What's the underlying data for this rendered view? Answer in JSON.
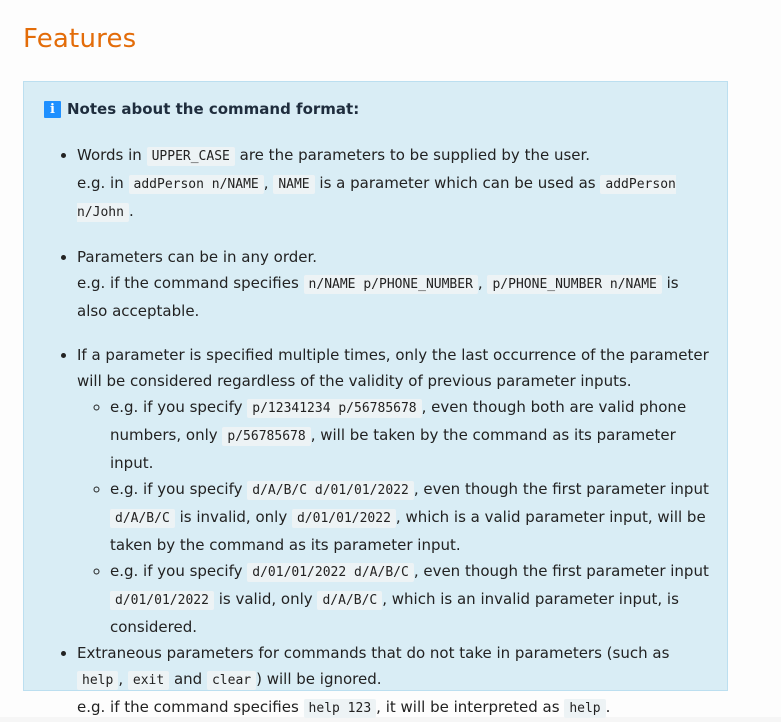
{
  "page": {
    "title": "Features"
  },
  "notes": {
    "heading": "Notes about the command format:",
    "icon": "info-icon",
    "items": [
      {
        "p1_a": "Words in",
        "p1_code1": "UPPER_CASE",
        "p1_b": "are the parameters to be supplied by the user.",
        "p2_a": "e.g. in",
        "p2_code1": "addPerson n/NAME",
        "p2_b": ",",
        "p2_code2": "NAME",
        "p2_c": "is a parameter which can be used as",
        "p2_code3": "addPerson n/John",
        "p2_d": "."
      },
      {
        "p1": "Parameters can be in any order.",
        "p2_a": "e.g. if the command specifies",
        "p2_code1": "n/NAME p/PHONE_NUMBER",
        "p2_b": ",",
        "p2_code2": "p/PHONE_NUMBER n/NAME",
        "p2_c": "is also acceptable."
      },
      {
        "p1": "If a parameter is specified multiple times, only the last occurrence of the parameter will be considered regardless of the validity of previous parameter inputs.",
        "sub": [
          {
            "a": "e.g. if you specify",
            "code1": "p/12341234 p/56785678",
            "b": ", even though both are valid phone numbers, only",
            "code2": "p/56785678",
            "c": ", will be taken by the command as its parameter input."
          },
          {
            "a": "e.g. if you specify",
            "code1": "d/A/B/C d/01/01/2022",
            "b": ", even though the first parameter input",
            "code2": "d/A/B/C",
            "c": "is invalid, only",
            "code3": "d/01/01/2022",
            "d": ", which is a valid parameter input, will be taken by the command as its parameter input."
          },
          {
            "a": "e.g. if you specify",
            "code1": "d/01/01/2022 d/A/B/C",
            "b": ", even though the first parameter input",
            "code2": "d/01/01/2022",
            "c": "is valid, only",
            "code3": "d/A/B/C",
            "d": ", which is an invalid parameter input, is considered."
          }
        ]
      },
      {
        "p1_a": "Extraneous parameters for commands that do not take in parameters (such as",
        "p1_code1": "help",
        "p1_b": ",",
        "p1_code2": "exit",
        "p1_c": "and",
        "p1_code3": "clear",
        "p1_d": ") will be ignored.",
        "p2_a": "e.g. if the command specifies",
        "p2_code1": "help 123",
        "p2_b": ", it will be interpreted as",
        "p2_code2": "help",
        "p2_c": "."
      }
    ]
  },
  "colors": {
    "title": "#e36c09",
    "box_bg": "#d9edf5",
    "icon_bg": "#1e90ff"
  }
}
